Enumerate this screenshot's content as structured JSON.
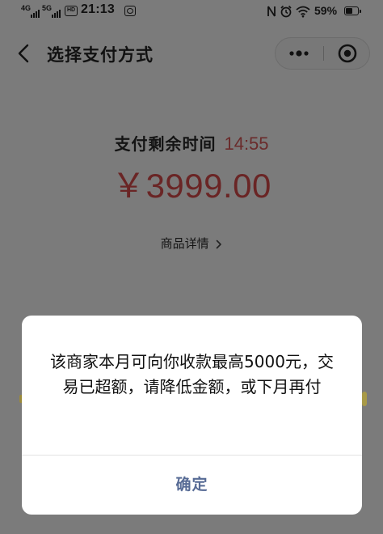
{
  "status_bar": {
    "network_1": "4G",
    "network_2": "5G",
    "hd_badge": "HD",
    "time": "21:13",
    "battery_percent_label": "59%",
    "battery_level": 0.59,
    "icons": [
      "nfc-icon",
      "alarm-icon",
      "wifi-icon",
      "battery-icon"
    ]
  },
  "titlebar": {
    "title": "选择支付方式",
    "back_icon": "chevron-left-icon",
    "more_icon": "more-dots-icon",
    "close_icon": "target-circle-icon"
  },
  "payment": {
    "countdown_label": "支付剩余时间",
    "countdown_time": "14:55",
    "amount": "￥3999.00",
    "details_label": "商品详情",
    "details_icon": "chevron-right-icon"
  },
  "dialog": {
    "message": "该商家本月可向你收款最高5000元，交易已超额，请降低金额，或下月再付",
    "confirm_label": "确定"
  },
  "colors": {
    "overlay_background": "#7b7b7b",
    "amount_color": "#6a2525",
    "countdown_color": "#6a2b2b",
    "dialog_button_color": "#576b95"
  }
}
